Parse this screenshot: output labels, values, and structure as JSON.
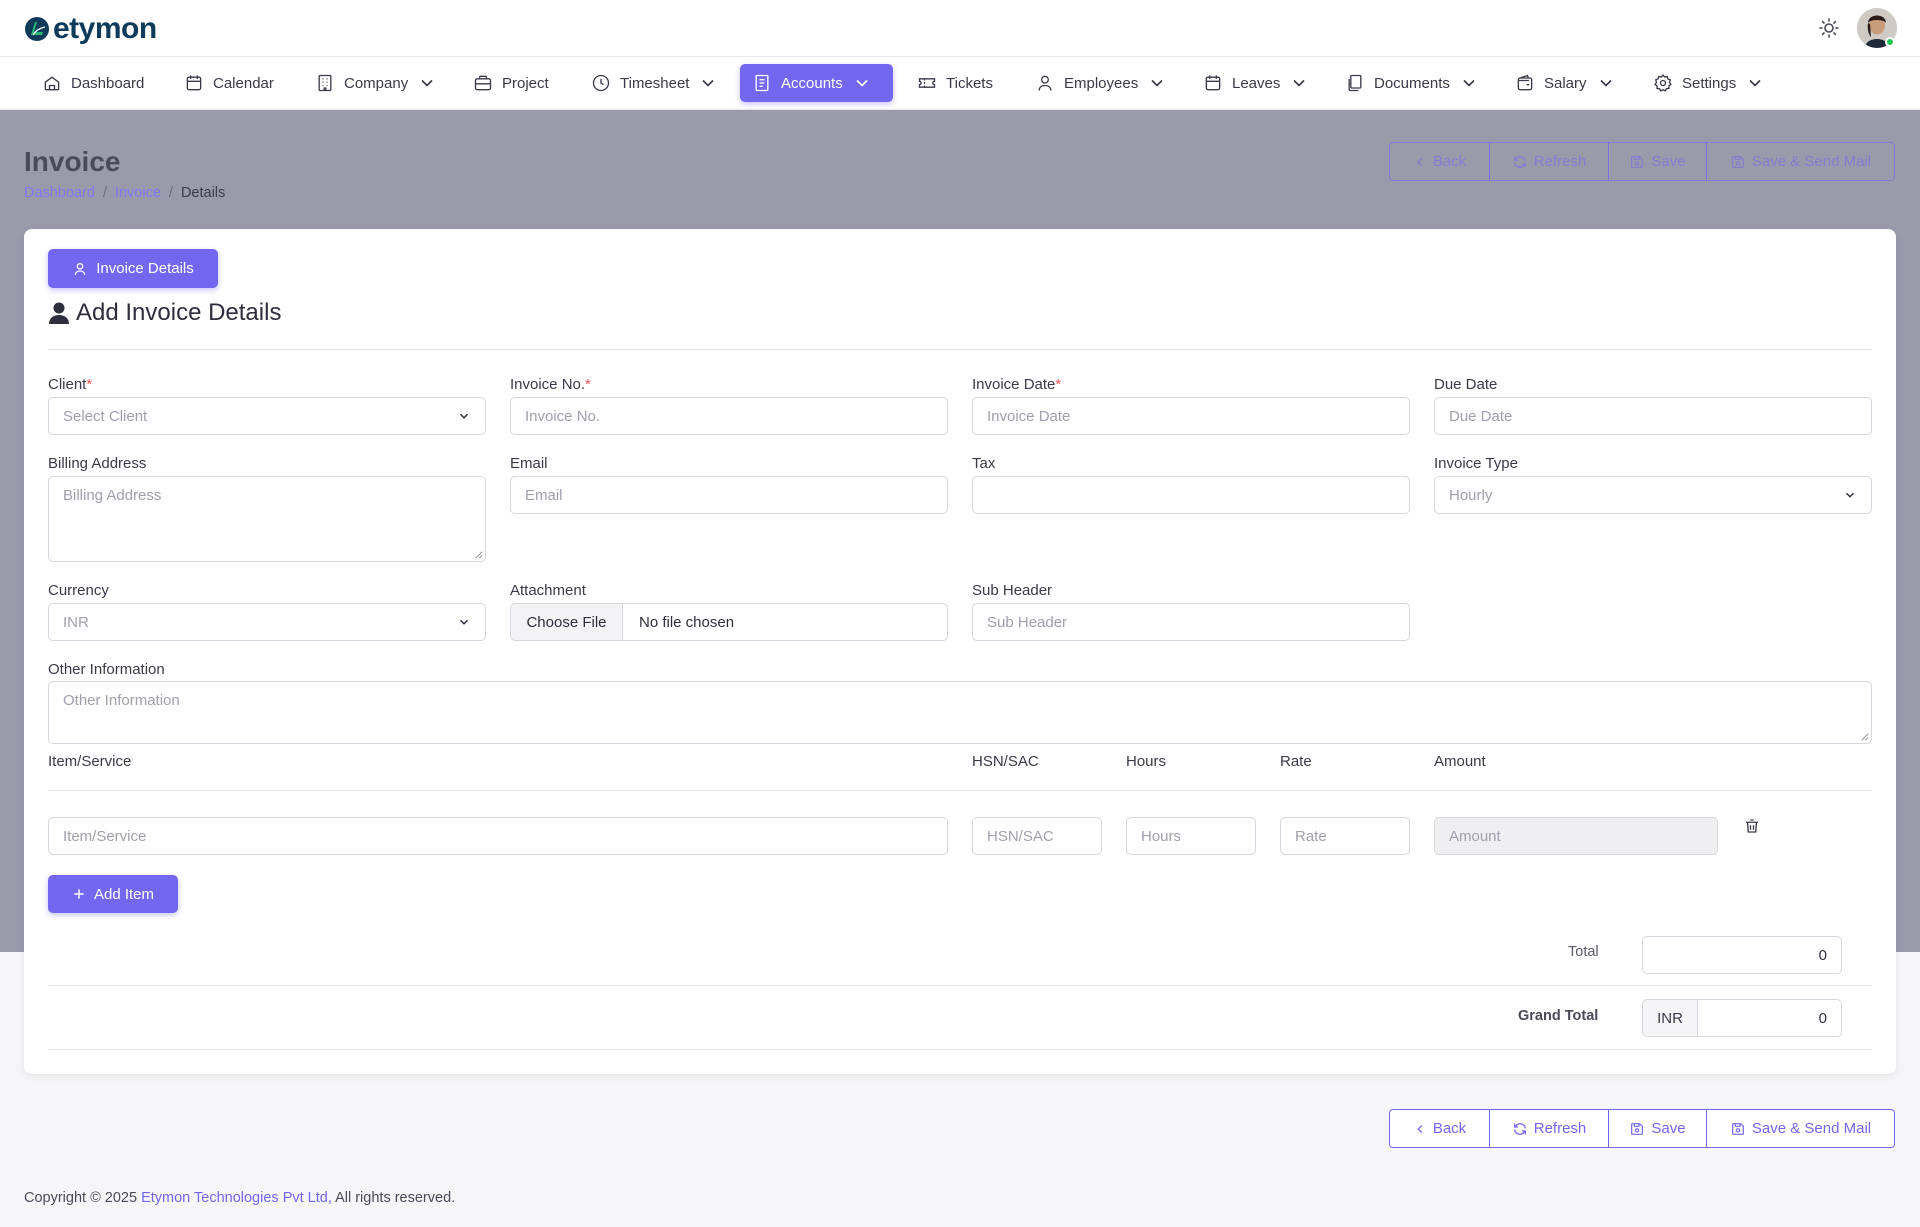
{
  "brand": {
    "name": "etymon"
  },
  "nav": [
    {
      "label": "Dashboard",
      "icon": "home-icon",
      "dropdown": false
    },
    {
      "label": "Calendar",
      "icon": "calendar-icon",
      "dropdown": false
    },
    {
      "label": "Company",
      "icon": "building-icon",
      "dropdown": true
    },
    {
      "label": "Project",
      "icon": "briefcase-icon",
      "dropdown": false
    },
    {
      "label": "Timesheet",
      "icon": "clock-icon",
      "dropdown": true
    },
    {
      "label": "Accounts",
      "icon": "receipt-icon",
      "dropdown": true,
      "active": true
    },
    {
      "label": "Tickets",
      "icon": "ticket-icon",
      "dropdown": false
    },
    {
      "label": "Employees",
      "icon": "user-icon",
      "dropdown": true
    },
    {
      "label": "Leaves",
      "icon": "calendar-icon",
      "dropdown": true
    },
    {
      "label": "Documents",
      "icon": "files-icon",
      "dropdown": true
    },
    {
      "label": "Salary",
      "icon": "wallet-icon",
      "dropdown": true
    },
    {
      "label": "Settings",
      "icon": "gear-icon",
      "dropdown": true
    }
  ],
  "page": {
    "title": "Invoice",
    "breadcrumb": [
      "Dashboard",
      "Invoice",
      "Details"
    ]
  },
  "actions": {
    "back": "Back",
    "refresh": "Refresh",
    "save": "Save",
    "save_send": "Save & Send Mail"
  },
  "card": {
    "tab_label": "Invoice Details",
    "section_title": "Add Invoice Details"
  },
  "form": {
    "client": {
      "label": "Client",
      "required": "*",
      "value": "Select Client"
    },
    "invoice_no": {
      "label": "Invoice No.",
      "required": "*",
      "placeholder": "Invoice No."
    },
    "invoice_date": {
      "label": "Invoice Date",
      "required": "*",
      "placeholder": "Invoice Date"
    },
    "due_date": {
      "label": "Due Date",
      "placeholder": "Due Date"
    },
    "billing_address": {
      "label": "Billing Address",
      "placeholder": "Billing Address"
    },
    "email": {
      "label": "Email",
      "placeholder": "Email"
    },
    "tax": {
      "label": "Tax",
      "placeholder": ""
    },
    "invoice_type": {
      "label": "Invoice Type",
      "value": "Hourly"
    },
    "currency": {
      "label": "Currency",
      "value": "INR"
    },
    "attachment": {
      "label": "Attachment",
      "button": "Choose File",
      "status": "No file chosen"
    },
    "sub_header": {
      "label": "Sub Header",
      "placeholder": "Sub Header"
    },
    "other_info": {
      "label": "Other Information",
      "placeholder": "Other Information"
    }
  },
  "items": {
    "columns": {
      "item": "Item/Service",
      "hsn": "HSN/SAC",
      "hours": "Hours",
      "rate": "Rate",
      "amount": "Amount"
    },
    "row": {
      "item": "Item/Service",
      "hsn": "HSN/SAC",
      "hours": "Hours",
      "rate": "Rate",
      "amount": "Amount"
    },
    "add_label": "Add Item"
  },
  "totals": {
    "total_label": "Total",
    "total_value": "0",
    "grand_label": "Grand Total",
    "currency": "INR",
    "grand_value": "0"
  },
  "footer": {
    "prefix": "Copyright © 2025 ",
    "company": "Etymon Technologies Pvt Ltd,",
    "suffix": " All rights reserved."
  },
  "colors": {
    "primary": "#7367f0",
    "required": "#ea5455",
    "online": "#23c552"
  }
}
